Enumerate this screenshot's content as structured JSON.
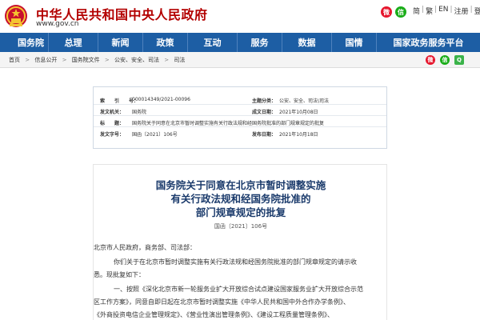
{
  "header": {
    "site_title": "中华人民共和国中央人民政府",
    "site_url": "www.gov.cn",
    "icons": [
      "weibo-icon",
      "wechat-icon"
    ],
    "links": [
      "简",
      "繁",
      "EN",
      "注册",
      "登录"
    ]
  },
  "nav": {
    "items": [
      "国务院",
      "总理",
      "新闻",
      "政策",
      "互动",
      "服务",
      "数据",
      "国情",
      "国家政务服务平台"
    ]
  },
  "breadcrumb": {
    "items": [
      "首页",
      "信息公开",
      "国务院文件",
      "公安、安全、司法",
      "司法"
    ],
    "separator": ">"
  },
  "info_table": {
    "index_label": "索　　引　　号：",
    "index_value": "000014349/2021-00096",
    "category_label": "主题分类：",
    "category_value": "公安、安全、司法\\司法",
    "issuer_label": "发文机关：",
    "issuer_value": "国务院",
    "written_label": "成文日期：",
    "written_value": "2021年10月08日",
    "title_label": "标　　题：",
    "title_value": "国务院关于同意在北京市暂时调整实施有关行政法规和经国务院批准的部门规章规定的批复",
    "docno_label": "发文字号：",
    "docno_value": "国函〔2021〕106号",
    "published_label": "发布日期：",
    "published_value": "2021年10月18日"
  },
  "article": {
    "title_lines": [
      "国务院关于同意在北京市暂时调整实施",
      "有关行政法规和经国务院批准的",
      "部门规章规定的批复"
    ],
    "doc_number": "国函〔2021〕106号",
    "salutation": "北京市人民政府，商务部、司法部：",
    "para1": [
      "你们关于在北京市暂时调整实施有关行政法规和经国务院批准的部门规章规定的请示收",
      "悉。现批复如下："
    ],
    "para2": [
      "一、按照《深化北京市新一轮服务业扩大开放综合试点建设国家服务业扩大开放综合示范",
      "区工作方案》，同意自即日起在北京市暂时调整实施《中华人民共和国中外合作办学条例》、",
      "《外商投资电信企业管理规定》、《营业性演出管理条例》、《建设工程质量管理条例》、"
    ]
  },
  "share": [
    "weibo-share-icon",
    "wechat-share-icon",
    "qzone-share-icon"
  ],
  "colors": {
    "brand_red": "#b30000",
    "nav_blue": "#1d5ea4",
    "title_blue": "#1a3a6b"
  }
}
